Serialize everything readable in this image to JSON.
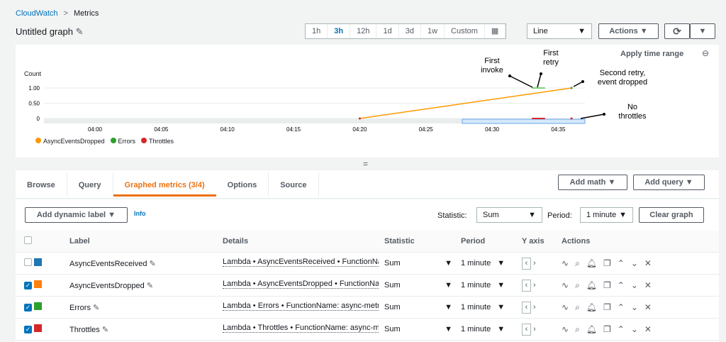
{
  "breadcrumb": {
    "root": "CloudWatch",
    "current": "Metrics"
  },
  "title": "Untitled graph",
  "time_ranges": [
    "1h",
    "3h",
    "12h",
    "1d",
    "3d",
    "1w",
    "Custom"
  ],
  "selected_range": "3h",
  "chart_type": "Line",
  "actions_label": "Actions",
  "apply_time_range": "Apply time range",
  "annotations": {
    "first_invoke": "First invoke",
    "first_retry": "First retry",
    "second_retry": "Second retry, event dropped",
    "no_throttles": "No throttles"
  },
  "chart_data": {
    "type": "line",
    "ylabel": "Count",
    "ylim": [
      0,
      1
    ],
    "yticks": [
      "1.00",
      "0.50",
      "0"
    ],
    "xticks": [
      "04:00",
      "04:05",
      "04:10",
      "04:15",
      "04:20",
      "04:25",
      "04:30",
      "04:35"
    ],
    "series": [
      {
        "name": "AsyncEventsDropped",
        "color": "#ff9900",
        "points": [
          [
            "04:20",
            0
          ],
          [
            "04:36",
            1
          ]
        ]
      },
      {
        "name": "Errors",
        "color": "#2ca02c",
        "points": [
          [
            "04:33",
            1
          ],
          [
            "04:34",
            1
          ],
          [
            "04:36",
            1
          ]
        ]
      },
      {
        "name": "Throttles",
        "color": "#d62728",
        "points": [
          [
            "04:20",
            0
          ],
          [
            "04:33",
            0
          ],
          [
            "04:34",
            0
          ],
          [
            "04:36",
            0
          ]
        ]
      }
    ]
  },
  "tabs": [
    "Browse",
    "Query",
    "Graphed metrics (3/4)",
    "Options",
    "Source"
  ],
  "active_tab": 2,
  "add_math": "Add math",
  "add_query": "Add query",
  "add_dynamic_label": "Add dynamic label",
  "info": "Info",
  "statistic_label": "Statistic:",
  "statistic_value": "Sum",
  "period_label": "Period:",
  "period_value": "1 minute",
  "clear_graph": "Clear graph",
  "columns": [
    "Label",
    "Details",
    "Statistic",
    "Period",
    "Y axis",
    "Actions"
  ],
  "rows": [
    {
      "checked": false,
      "color": "#1f77b4",
      "label": "AsyncEventsReceived",
      "details": "Lambda • AsyncEventsReceived • FunctionName: async-metrics",
      "statistic": "Sum",
      "period": "1 minute"
    },
    {
      "checked": true,
      "color": "#ff7f0e",
      "label": "AsyncEventsDropped",
      "details": "Lambda • AsyncEventsDropped • FunctionName: async-metrics",
      "statistic": "Sum",
      "period": "1 minute"
    },
    {
      "checked": true,
      "color": "#2ca02c",
      "label": "Errors",
      "details": "Lambda • Errors • FunctionName: async-metrics",
      "statistic": "Sum",
      "period": "1 minute"
    },
    {
      "checked": true,
      "color": "#d62728",
      "label": "Throttles",
      "details": "Lambda • Throttles • FunctionName: async-metrics",
      "statistic": "Sum",
      "period": "1 minute"
    }
  ]
}
